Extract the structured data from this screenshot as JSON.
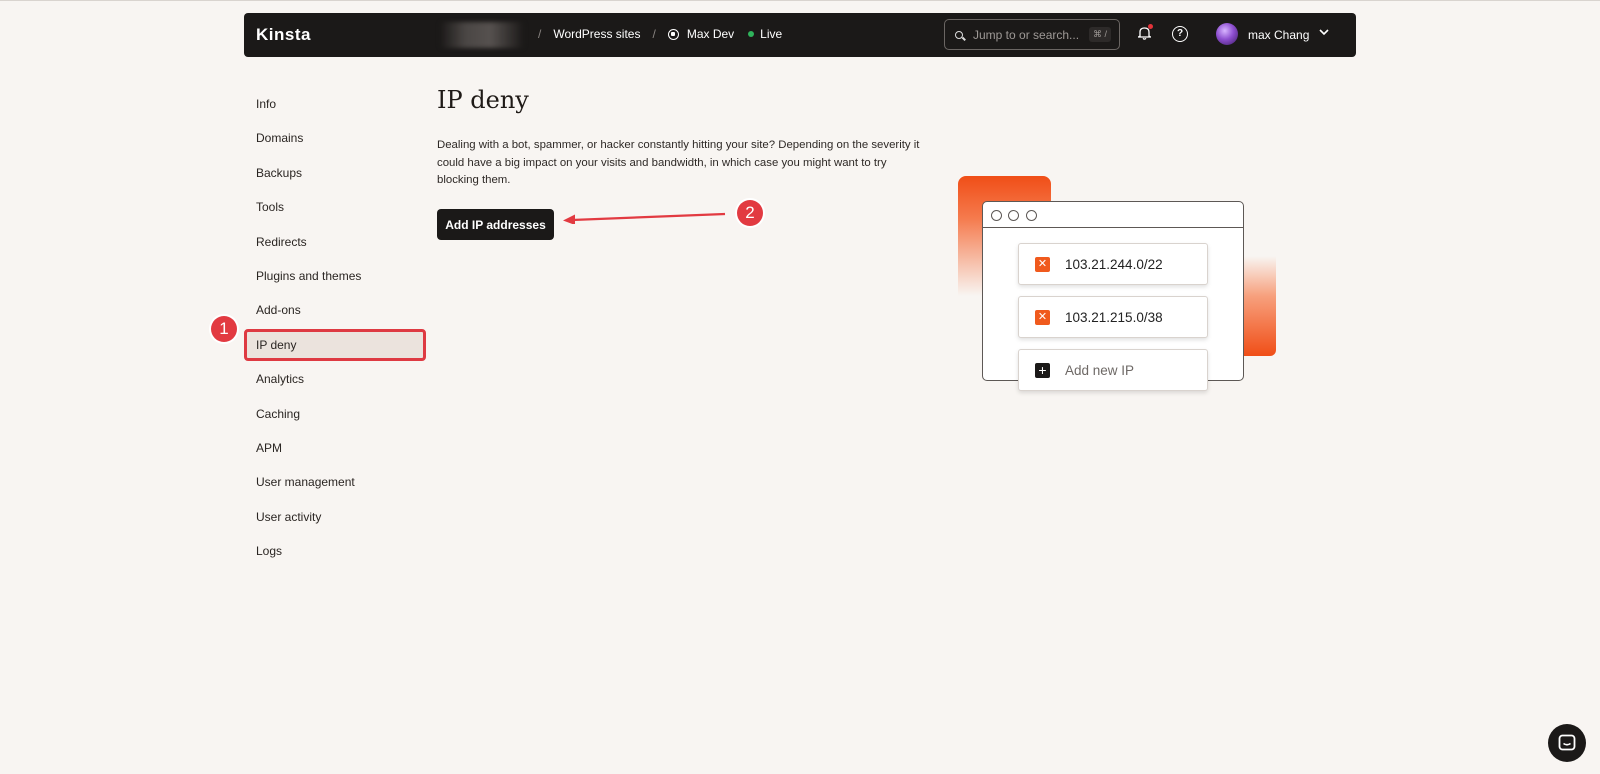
{
  "topbar": {
    "logo": "Kinsta",
    "breadcrumb": [
      "WordPress sites",
      "Max Dev",
      "Live"
    ],
    "search": {
      "placeholder": "Jump to or search...",
      "shortcut": "⌘ /"
    },
    "user_name": "max Chang"
  },
  "sidebar": {
    "items": [
      "Info",
      "Domains",
      "Backups",
      "Tools",
      "Redirects",
      "Plugins and themes",
      "Add-ons",
      "IP deny",
      "Analytics",
      "Caching",
      "APM",
      "User management",
      "User activity",
      "Logs"
    ],
    "active": "IP deny"
  },
  "main": {
    "title": "IP deny",
    "description": "Dealing with a bot, spammer, or hacker constantly hitting your site? Depending on the severity it could have a big impact on your visits and bandwidth, in which case you might want to try blocking them.",
    "add_button": "Add IP addresses"
  },
  "illustration": {
    "ips": [
      "103.21.244.0/22",
      "103.21.215.0/38"
    ],
    "add_label": "Add new IP"
  },
  "callouts": [
    "1",
    "2"
  ],
  "colors": {
    "accent": "#f04e17",
    "callout": "#e23a41",
    "dark": "#1b1918",
    "live": "#2fb35b"
  }
}
